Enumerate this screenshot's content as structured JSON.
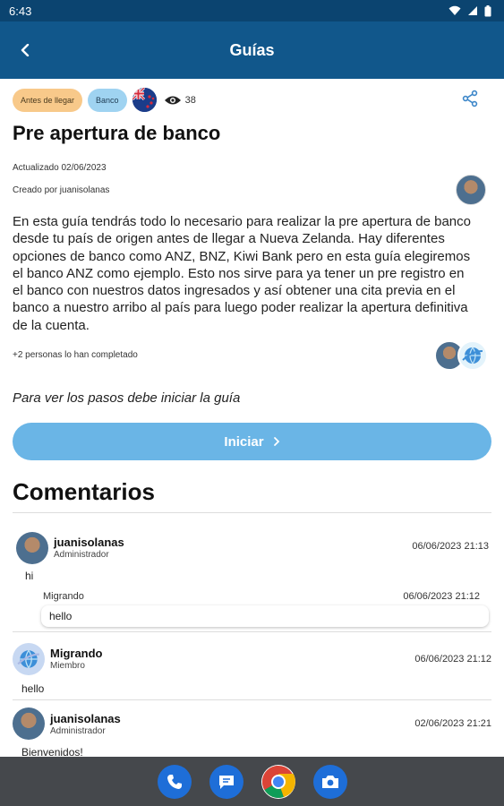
{
  "status_bar": {
    "time": "6:43"
  },
  "app_bar": {
    "title": "Guías"
  },
  "guide": {
    "tags": [
      "Antes de llegar",
      "Banco"
    ],
    "views": "38",
    "title": "Pre apertura de banco",
    "updated": "Actualizado 02/06/2023",
    "created_by": "Creado por juanisolanas",
    "description": "En esta guía tendrás todo lo necesario para realizar la pre apertura de banco desde tu país de origen antes de llegar a Nueva Zelanda. Hay diferentes opciones de banco como ANZ, BNZ, Kiwi Bank pero en esta guía elegiremos el banco ANZ como ejemplo. Esto nos sirve para ya tener un pre registro en el banco con nuestros datos ingresados y así obtener una cita previa en el banco a nuestro arribo al país para luego poder realizar la apertura definitiva de la cuenta.",
    "completed_text": "+2 personas lo han completado",
    "steps_note": "Para ver los pasos debe iniciar la guía",
    "start_label": "Iniciar"
  },
  "comments": {
    "title": "Comentarios",
    "items": [
      {
        "name": "juanisolanas",
        "role": "Administrador",
        "date": "06/06/2023 21:13",
        "text": "hi",
        "reply": {
          "name": "Migrando",
          "date": "06/06/2023 21:12",
          "text": "hello"
        }
      },
      {
        "name": "Migrando",
        "role": "Miembro",
        "date": "06/06/2023 21:12",
        "text": "hello"
      },
      {
        "name": "juanisolanas",
        "role": "Administrador",
        "date": "02/06/2023 21:21",
        "text": "Bienvenidos!"
      }
    ]
  },
  "nav_apps": [
    "phone-icon",
    "messages-icon",
    "chrome-icon",
    "camera-icon"
  ],
  "colors": {
    "app_bar": "#11578b",
    "status_bar": "#0b4470",
    "start_button": "#6ab5e6",
    "tag_orange": "#f8c98a",
    "tag_blue": "#9fd3f1"
  }
}
